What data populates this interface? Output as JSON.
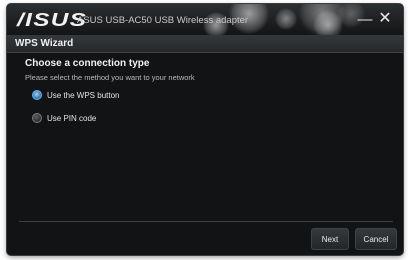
{
  "window": {
    "logo": "/ISUS",
    "title": "ASUS USB-AC50 USB Wireless adapter",
    "minimize_glyph": "—",
    "close_glyph": "✕"
  },
  "section": {
    "title": "WPS Wizard"
  },
  "content": {
    "heading": "Choose a connection type",
    "subtext": "Please select the method you want to your network",
    "options": [
      {
        "label": "Use the WPS button",
        "selected": true
      },
      {
        "label": "Use PIN code",
        "selected": false
      }
    ]
  },
  "footer": {
    "next_label": "Next",
    "cancel_label": "Cancel"
  },
  "colors": {
    "background": "#121314",
    "accent": "#3c86c2",
    "text": "#f2f2f2"
  }
}
